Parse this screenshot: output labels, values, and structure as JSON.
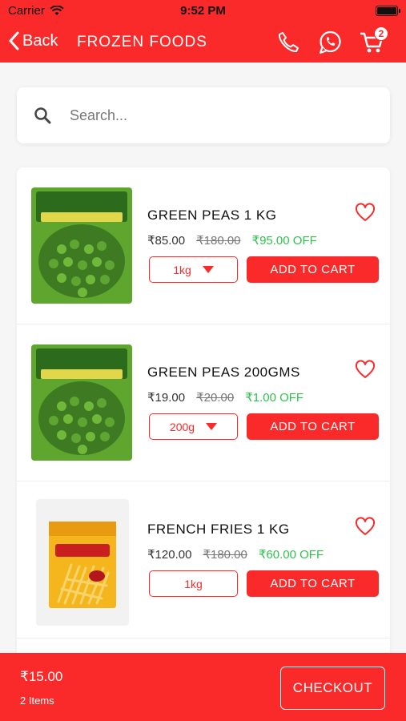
{
  "status_bar": {
    "carrier": "Carrier",
    "time": "9:52 PM"
  },
  "nav": {
    "back_label": "Back",
    "title": "FROZEN FOODS",
    "cart_count": "2",
    "icons": [
      "chevron-left-icon",
      "phone-icon",
      "whatsapp-icon",
      "cart-icon"
    ]
  },
  "search": {
    "placeholder": "Search..."
  },
  "products": [
    {
      "name": "GREEN PEAS 1 KG",
      "price": "₹85.00",
      "mrp": "₹180.00",
      "off": "₹95.00 OFF",
      "size": "1kg",
      "has_dropdown": true,
      "add_label": "ADD TO CART",
      "image": "green-peas-pack"
    },
    {
      "name": "GREEN PEAS 200GMS",
      "price": "₹19.00",
      "mrp": "₹20.00",
      "off": "₹1.00 OFF",
      "size": "200g",
      "has_dropdown": true,
      "add_label": "ADD TO CART",
      "image": "green-peas-pack"
    },
    {
      "name": "FRENCH FRIES 1 KG",
      "price": "₹120.00",
      "mrp": "₹180.00",
      "off": "₹60.00 OFF",
      "size": "1kg",
      "has_dropdown": false,
      "add_label": "ADD TO CART",
      "image": "french-fries-pack"
    }
  ],
  "footer": {
    "total": "₹15.00",
    "items": "2 Items",
    "checkout_label": "CHECKOUT"
  },
  "colors": {
    "accent": "#fb2a2a",
    "discount": "#2ec24d"
  }
}
